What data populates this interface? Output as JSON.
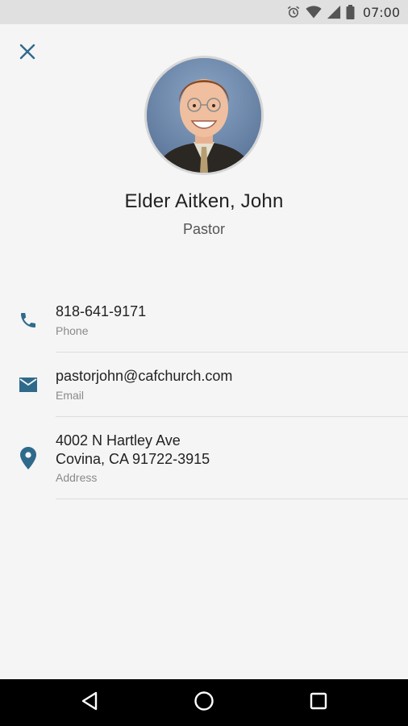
{
  "status_bar": {
    "time": "07:00",
    "icons": [
      "alarm-icon",
      "wifi-icon",
      "signal-icon",
      "battery-icon"
    ]
  },
  "toolbar": {
    "close_icon": "close-icon"
  },
  "contact": {
    "name": "Elder Aitken, John",
    "role": "Pastor"
  },
  "details": [
    {
      "icon": "phone-icon",
      "value": "818-641-9171",
      "label": "Phone"
    },
    {
      "icon": "email-icon",
      "value": "pastorjohn@cafchurch.com",
      "label": "Email"
    },
    {
      "icon": "location-pin-icon",
      "value": "4002 N Hartley Ave\nCovina, CA 91722-3915",
      "label": "Address"
    }
  ],
  "nav_bar": {
    "buttons": [
      "back-icon",
      "home-icon",
      "recents-icon"
    ]
  },
  "colors": {
    "accent": "#2f6a8c",
    "background": "#f5f5f5",
    "status_bar": "#e0e0e0",
    "nav_bar": "#000000",
    "divider": "#dcdcdc"
  }
}
